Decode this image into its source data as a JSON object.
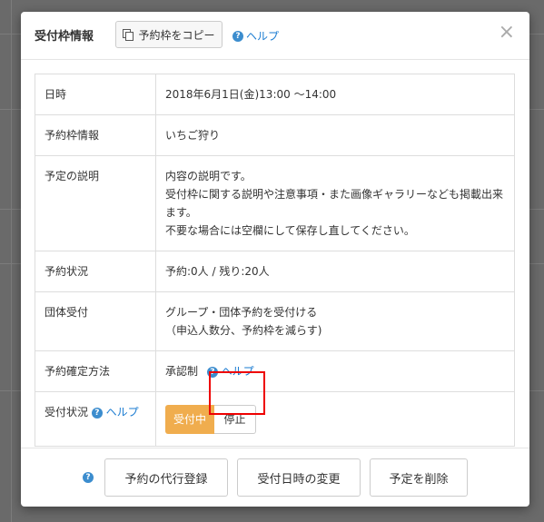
{
  "modal": {
    "title": "受付枠情報",
    "copy_button": "予約枠をコピー",
    "help": "ヘルプ",
    "close": "×"
  },
  "rows": [
    {
      "label": "日時",
      "value": "2018年6月1日(金)13:00 〜14:00"
    },
    {
      "label": "予約枠情報",
      "value": "いちご狩り"
    },
    {
      "label": "予定の説明",
      "lines": [
        "内容の説明です。",
        "受付枠に関する説明や注意事項・また画像ギャラリーなども掲載出来",
        "ます。",
        "不要な場合には空欄にして保存し直してください。"
      ]
    },
    {
      "label": "予約状況",
      "value": "予約:0人 / 残り:20人"
    },
    {
      "label": "団体受付",
      "lines": [
        "グループ・団体予約を受付ける",
        "（申込人数分、予約枠を減らす)"
      ]
    },
    {
      "label": "予約確定方法",
      "value": "承認制",
      "help": "ヘルプ"
    },
    {
      "label": "受付状況",
      "help": "ヘルプ",
      "active_button": "受付中",
      "stop_button": "停止"
    }
  ],
  "footer": {
    "proxy_register": "予約の代行登録",
    "change_datetime": "受付日時の変更",
    "delete": "予定を削除"
  },
  "colors": {
    "accent": "#f0ad4e",
    "link": "#1a7bd1",
    "highlight": "#e00000"
  }
}
